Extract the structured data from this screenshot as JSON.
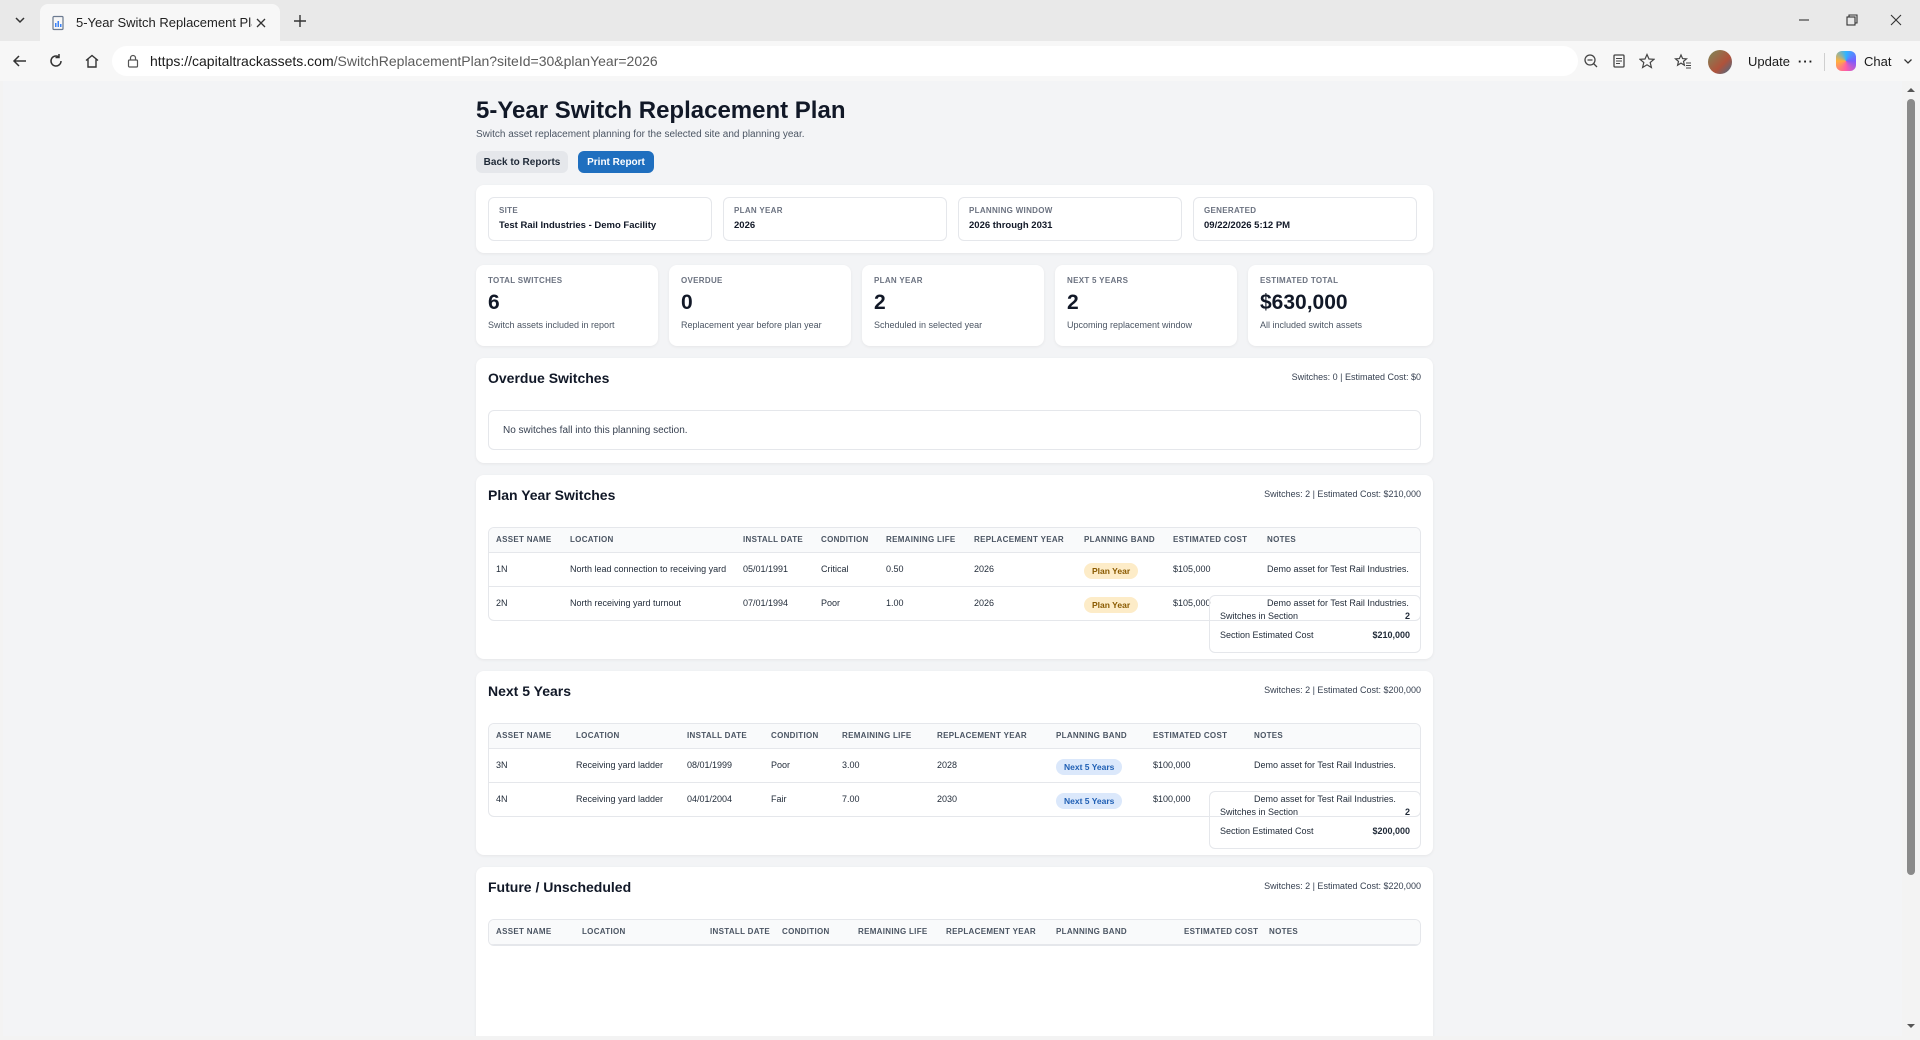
{
  "browser": {
    "tab_title": "5-Year Switch Replacement Plan",
    "url_host": "https://capitaltrackassets.com",
    "url_path": "/SwitchReplacementPlan?siteId=30&planYear=2026",
    "update_label": "Update",
    "chat_label": "Chat"
  },
  "header": {
    "title": "5-Year Switch Replacement Plan",
    "subtitle": "Switch asset replacement planning for the selected site and planning year.",
    "back_label": "Back to Reports",
    "print_label": "Print Report"
  },
  "info": [
    {
      "label": "SITE",
      "value": "Test Rail Industries - Demo Facility"
    },
    {
      "label": "PLAN YEAR",
      "value": "2026"
    },
    {
      "label": "PLANNING WINDOW",
      "value": "2026 through 2031"
    },
    {
      "label": "GENERATED",
      "value": "09/22/2026 5:12 PM"
    }
  ],
  "stats": [
    {
      "label": "TOTAL SWITCHES",
      "value": "6",
      "note": "Switch assets included in report"
    },
    {
      "label": "OVERDUE",
      "value": "0",
      "note": "Replacement year before plan year"
    },
    {
      "label": "PLAN YEAR",
      "value": "2",
      "note": "Scheduled in selected year"
    },
    {
      "label": "NEXT 5 YEARS",
      "value": "2",
      "note": "Upcoming replacement window"
    },
    {
      "label": "ESTIMATED TOTAL",
      "value": "$630,000",
      "note": "All included switch assets"
    }
  ],
  "columns": [
    "ASSET NAME",
    "LOCATION",
    "INSTALL DATE",
    "CONDITION",
    "REMAINING LIFE",
    "REPLACEMENT YEAR",
    "PLANNING BAND",
    "ESTIMATED COST",
    "NOTES"
  ],
  "overdue": {
    "title": "Overdue Switches",
    "summary": "Switches: 0 | Estimated Cost: $0",
    "empty": "No switches fall into this planning section."
  },
  "plan_year": {
    "title": "Plan Year Switches",
    "summary": "Switches: 2 | Estimated Cost: $210,000",
    "rows": [
      {
        "asset": "1N",
        "location": "North lead connection to receiving yard",
        "install": "05/01/1991",
        "condition": "Critical",
        "life": "0.50",
        "year": "2026",
        "band": "Plan Year",
        "cost": "$105,000",
        "notes": "Demo asset for Test Rail Industries."
      },
      {
        "asset": "2N",
        "location": "North receiving yard turnout",
        "install": "07/01/1994",
        "condition": "Poor",
        "life": "1.00",
        "year": "2026",
        "band": "Plan Year",
        "cost": "$105,000",
        "notes": "Demo asset for Test Rail Industries."
      }
    ],
    "totals_count_label": "Switches in Section",
    "totals_count": "2",
    "totals_cost_label": "Section Estimated Cost",
    "totals_cost": "$210,000"
  },
  "next5": {
    "title": "Next 5 Years",
    "summary": "Switches: 2 | Estimated Cost: $200,000",
    "rows": [
      {
        "asset": "3N",
        "location": "Receiving yard ladder",
        "install": "08/01/1999",
        "condition": "Poor",
        "life": "3.00",
        "year": "2028",
        "band": "Next 5 Years",
        "cost": "$100,000",
        "notes": "Demo asset for Test Rail Industries."
      },
      {
        "asset": "4N",
        "location": "Receiving yard ladder",
        "install": "04/01/2004",
        "condition": "Fair",
        "life": "7.00",
        "year": "2030",
        "band": "Next 5 Years",
        "cost": "$100,000",
        "notes": "Demo asset for Test Rail Industries."
      }
    ],
    "totals_count_label": "Switches in Section",
    "totals_count": "2",
    "totals_cost_label": "Section Estimated Cost",
    "totals_cost": "$200,000"
  },
  "future": {
    "title": "Future / Unscheduled",
    "summary": "Switches: 2 | Estimated Cost: $220,000"
  },
  "colors": {
    "primary": "#1f6fbf",
    "badge_plan_bg": "#fdecc8",
    "badge_next_bg": "#dbe8fb"
  }
}
